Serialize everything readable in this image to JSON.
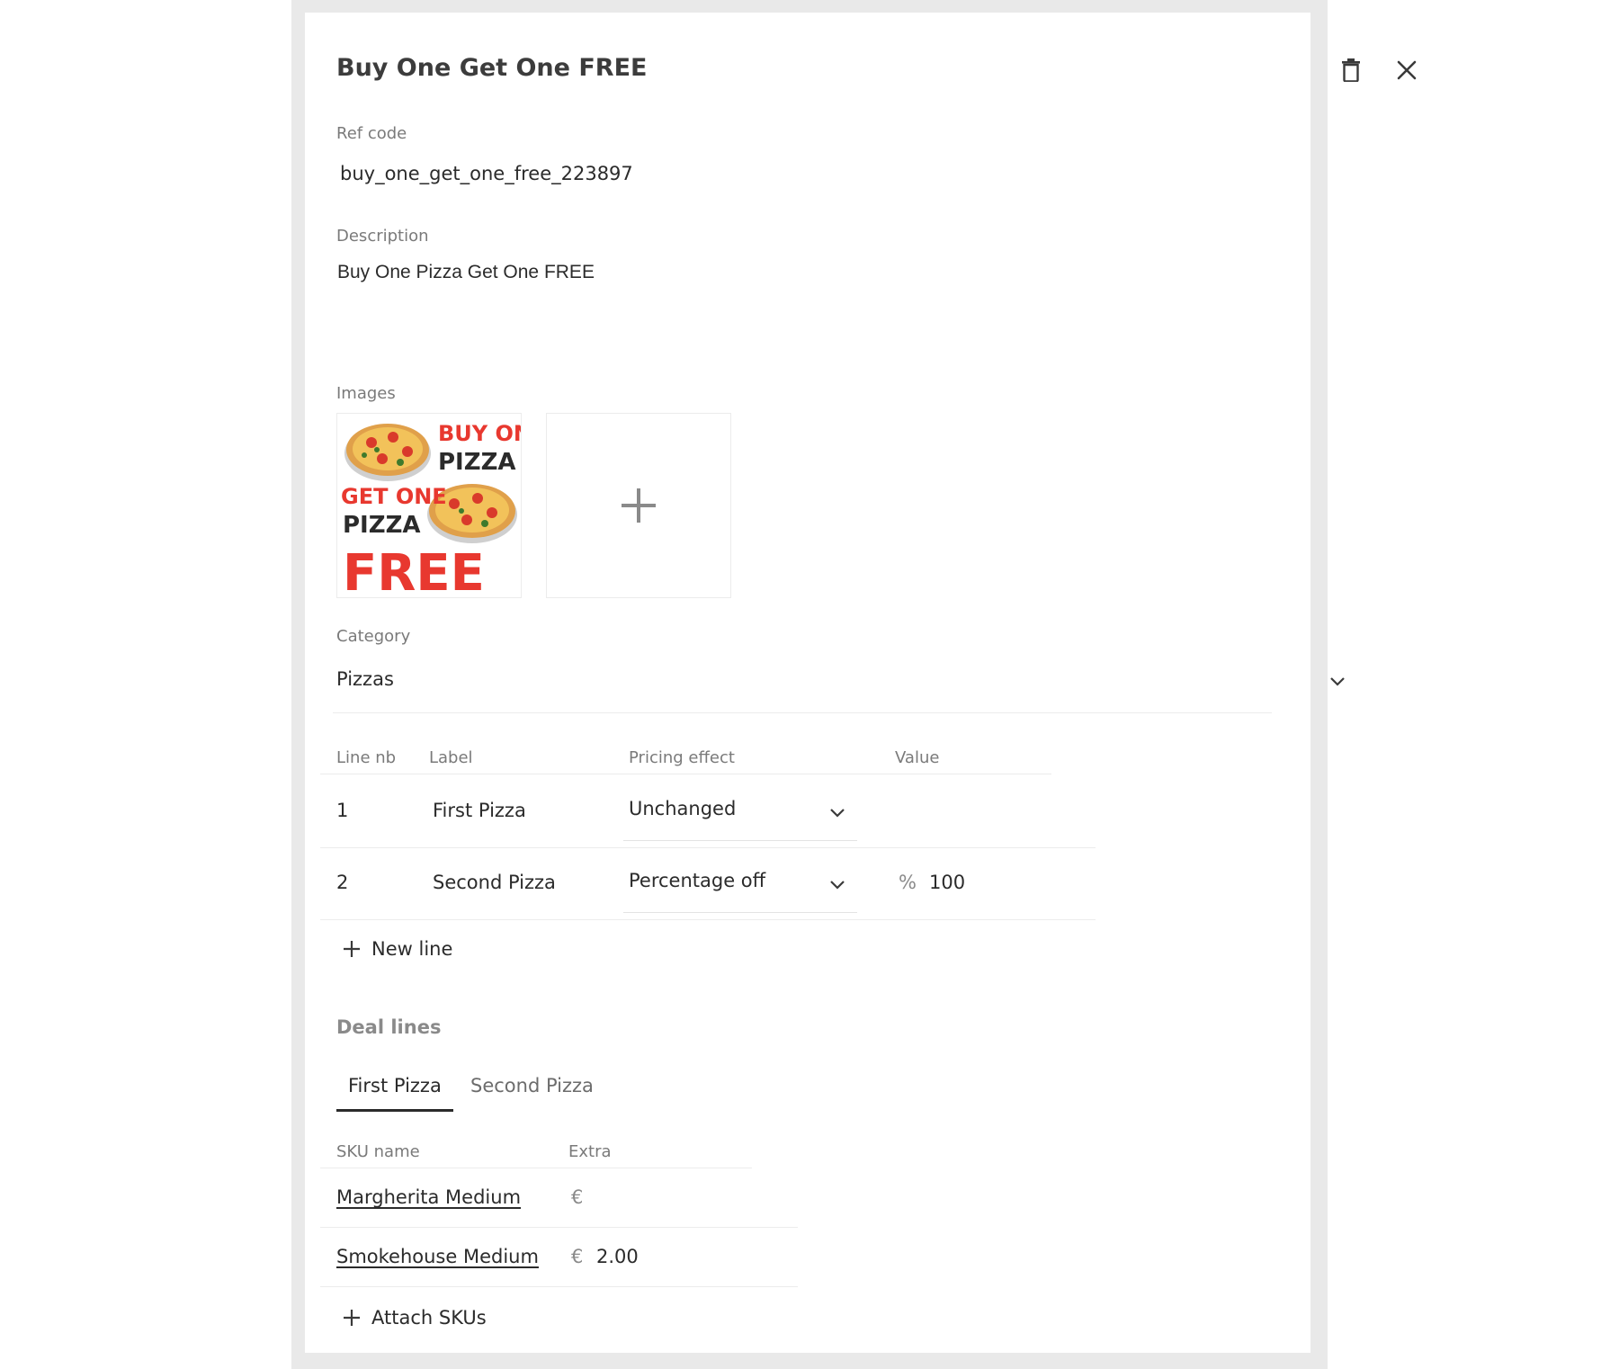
{
  "header": {
    "title": "Buy One Get One FREE",
    "delete_icon": "trash-icon",
    "close_icon": "close-icon"
  },
  "ref_code": {
    "label": "Ref code",
    "value": "buy_one_get_one_free_223897"
  },
  "description": {
    "label": "Description",
    "value": "Buy One Pizza Get One FREE"
  },
  "images": {
    "label": "Images",
    "thumbnail": {
      "line1": "BUY ONE",
      "line2": "PIZZA",
      "line3": "GET ONE",
      "line4": "PIZZA",
      "line5": "FREE"
    },
    "add_icon": "plus-icon"
  },
  "category": {
    "label": "Category",
    "value": "Pizzas",
    "icon": "chevron-down-icon"
  },
  "lines_table": {
    "headers": [
      "Line nb",
      "Label",
      "Pricing effect",
      "Value"
    ],
    "rows": [
      {
        "nb": "1",
        "label": "First Pizza",
        "effect": "Unchanged",
        "unit": "",
        "value": ""
      },
      {
        "nb": "2",
        "label": "Second Pizza",
        "effect": "Percentage off",
        "unit": "%",
        "value": "100"
      }
    ],
    "new_line_label": "New line"
  },
  "deal_lines": {
    "title": "Deal lines",
    "tabs": [
      "First Pizza",
      "Second Pizza"
    ],
    "active_tab": 0,
    "headers": [
      "SKU name",
      "Extra"
    ],
    "rows": [
      {
        "sku": "Margherita Medium",
        "currency": "€",
        "extra": ""
      },
      {
        "sku": "Smokehouse Medium",
        "currency": "€",
        "extra": "2.00"
      }
    ],
    "attach_label": "Attach SKUs"
  },
  "colors": {
    "accent_red": "#e8382f",
    "text_dark": "#2b2b2b",
    "label_gray": "#7a7a7a",
    "backdrop": "#e9e9e9"
  }
}
